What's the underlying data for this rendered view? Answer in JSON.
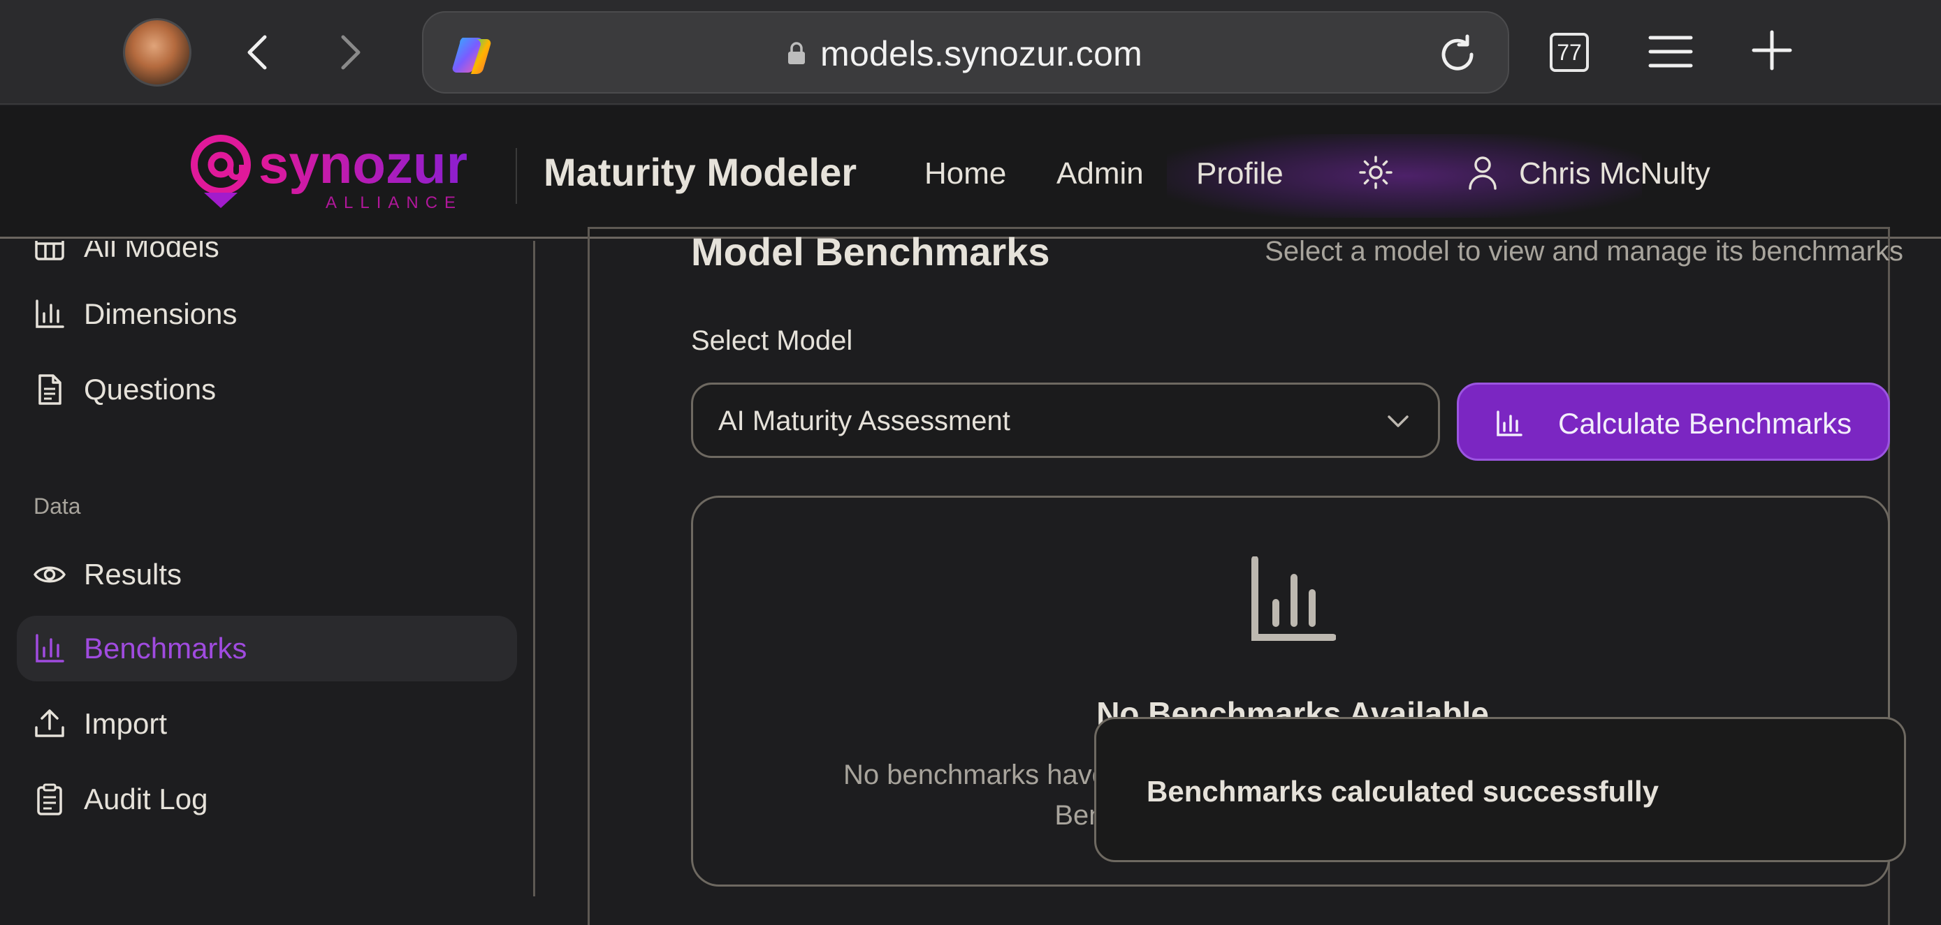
{
  "browser": {
    "url": "models.synozur.com",
    "tab_count": "77"
  },
  "header": {
    "logo_text": "synozur",
    "logo_subtext": "ALLIANCE",
    "app_title": "Maturity Modeler",
    "nav": [
      "Home",
      "Admin",
      "Profile"
    ],
    "user_name": "Chris McNulty"
  },
  "sidebar": {
    "items_top": [
      {
        "label": "All Models",
        "icon": "table-icon"
      },
      {
        "label": "Dimensions",
        "icon": "bar-chart-icon"
      },
      {
        "label": "Questions",
        "icon": "document-icon"
      }
    ],
    "section_label": "Data",
    "items_data": [
      {
        "label": "Results",
        "icon": "eye-icon"
      },
      {
        "label": "Benchmarks",
        "icon": "bar-chart-icon",
        "active": true
      },
      {
        "label": "Import",
        "icon": "upload-icon"
      },
      {
        "label": "Audit Log",
        "icon": "clipboard-icon"
      }
    ]
  },
  "main": {
    "title": "Model Benchmarks",
    "subtitle": "Select a model to view and manage its benchmarks",
    "select_label": "Select Model",
    "selected_model": "AI Maturity Assessment",
    "calc_button": "Calculate Benchmarks",
    "empty_title": "No Benchmarks Available",
    "empty_desc": "No benchmarks have been calculated for this model yet. Click \"Calculate Benchmarks\" above to generate them."
  },
  "toast": {
    "message": "Benchmarks calculated successfully"
  },
  "colors": {
    "accent": "#7b26c2",
    "active_text": "#a04bdf",
    "logo_pink": "#e0199a",
    "logo_purple": "#8b1fd0"
  }
}
